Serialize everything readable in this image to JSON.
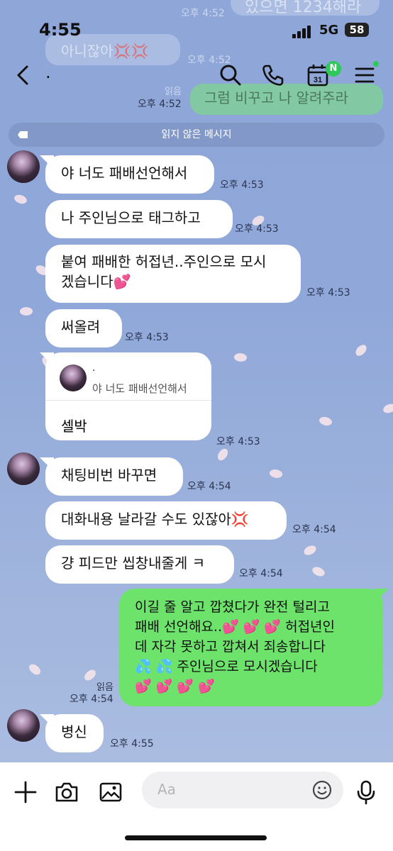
{
  "status_bar": {
    "time": "4:55",
    "network": "5G",
    "battery": "58"
  },
  "header": {
    "back_icon": "chevron-left-icon",
    "chat_name": ".",
    "icons": [
      "search-icon",
      "phone-icon",
      "calendar-icon",
      "menu-icon"
    ],
    "calendar_day": "31",
    "calendar_badge": "N"
  },
  "ghost_history": {
    "top_right_text": "있으면 1234해라",
    "top_ts": "오후 4:52",
    "left_text": "아니잖아💢💢",
    "left_ts": "오후 4:52",
    "read": "읽음",
    "green_text": "그럼 비꾸고 나 알려주라",
    "green_ts": "오후 4:52"
  },
  "unread_divider": "읽지 않은 메시지",
  "messages": [
    {
      "text": "야 너도 패배선언해서",
      "time": "오후 4:53"
    },
    {
      "text": "나 주인님으로 태그하고",
      "time": "오후 4:53"
    },
    {
      "line1": "붙여 패배한 허접년..주인으로 모시",
      "line2": "겠습니다💕",
      "time": "오후 4:53"
    },
    {
      "text": "써올려",
      "time": "오후 4:53"
    },
    {
      "reply_name": ".",
      "reply_quote": "야 너도 패배선언해서",
      "text": "셀박",
      "time": "오후 4:53"
    },
    {
      "text": "채팅비번 바꾸면",
      "time": "오후 4:54"
    },
    {
      "text": "대화내용 날라갈 수도 있잖아💢",
      "time": "오후 4:54"
    },
    {
      "text": "걍 피드만 씹창내줄게 ㅋ",
      "time": "오후 4:54"
    }
  ],
  "my_message": {
    "lines": [
      "이길 줄 알고 깝쳤다가 완전 털리고",
      "패배 선언해요..💕 💕 💕 허접년인",
      "데 자각 못하고 깝쳐서 죄송합니다",
      "💦 💦 주인님으로 모시겠습니다",
      "💕 💕 💕 💕"
    ],
    "read": "읽음",
    "time": "오후 4:54"
  },
  "last_message": {
    "text": "병신",
    "time": "오후 4:55"
  },
  "input_bar": {
    "placeholder": "Aa",
    "icons": [
      "plus-icon",
      "camera-icon",
      "image-icon",
      "emoji-icon",
      "microphone-icon"
    ]
  }
}
